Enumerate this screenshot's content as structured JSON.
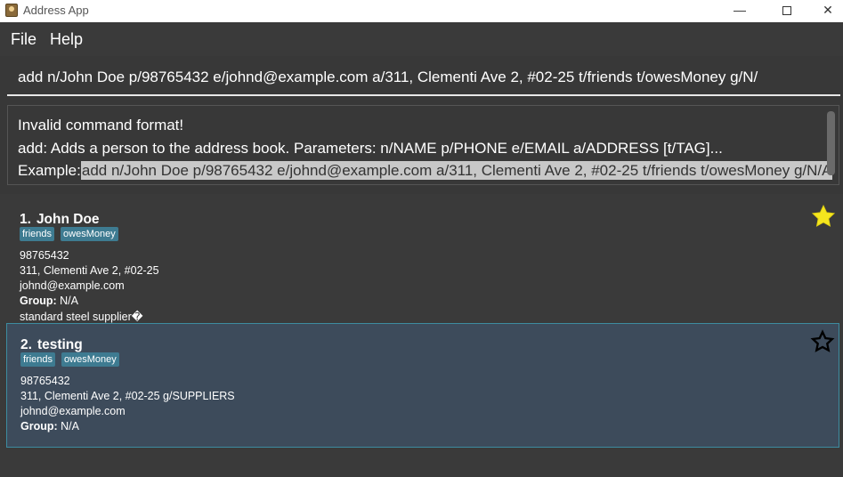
{
  "window": {
    "title": "Address App",
    "min": "—",
    "close": "✕"
  },
  "menu": {
    "file": "File",
    "help": "Help"
  },
  "command": {
    "value": "add n/John Doe p/98765432 e/johnd@example.com a/311, Clementi Ave 2, #02-25 t/friends t/owesMoney g/N/"
  },
  "result": {
    "line1": "Invalid command format!",
    "line2": "add: Adds a person to the address book. Parameters: n/NAME p/PHONE e/EMAIL a/ADDRESS [t/TAG]...",
    "line3_prefix": "Example:",
    "line3_example": "add n/John Doe p/98765432 e/johnd@example.com a/311, Clementi Ave 2, #02-25 t/friends t/owesMoney g/N/A"
  },
  "persons": [
    {
      "index": "1.",
      "name": "John Doe",
      "tags": [
        "friends",
        "owesMoney"
      ],
      "phone": "98765432",
      "address": "311, Clementi Ave 2, #02-25",
      "email": "johnd@example.com",
      "group_label": "Group:",
      "group": "N/A",
      "note": "standard steel supplier�",
      "favorite": true,
      "star_color": "#f5e61e"
    },
    {
      "index": "2.",
      "name": "testing",
      "tags": [
        "friends",
        "owesMoney"
      ],
      "phone": "98765432",
      "address": "311, Clementi Ave 2, #02-25 g/SUPPLIERS",
      "email": "johnd@example.com",
      "group_label": "Group:",
      "group": "N/A",
      "favorite": false,
      "star_color": "#000000"
    }
  ],
  "colors": {
    "background": "#383838",
    "selected_card": "#3d4b5b",
    "tag": "#3e7b91"
  }
}
